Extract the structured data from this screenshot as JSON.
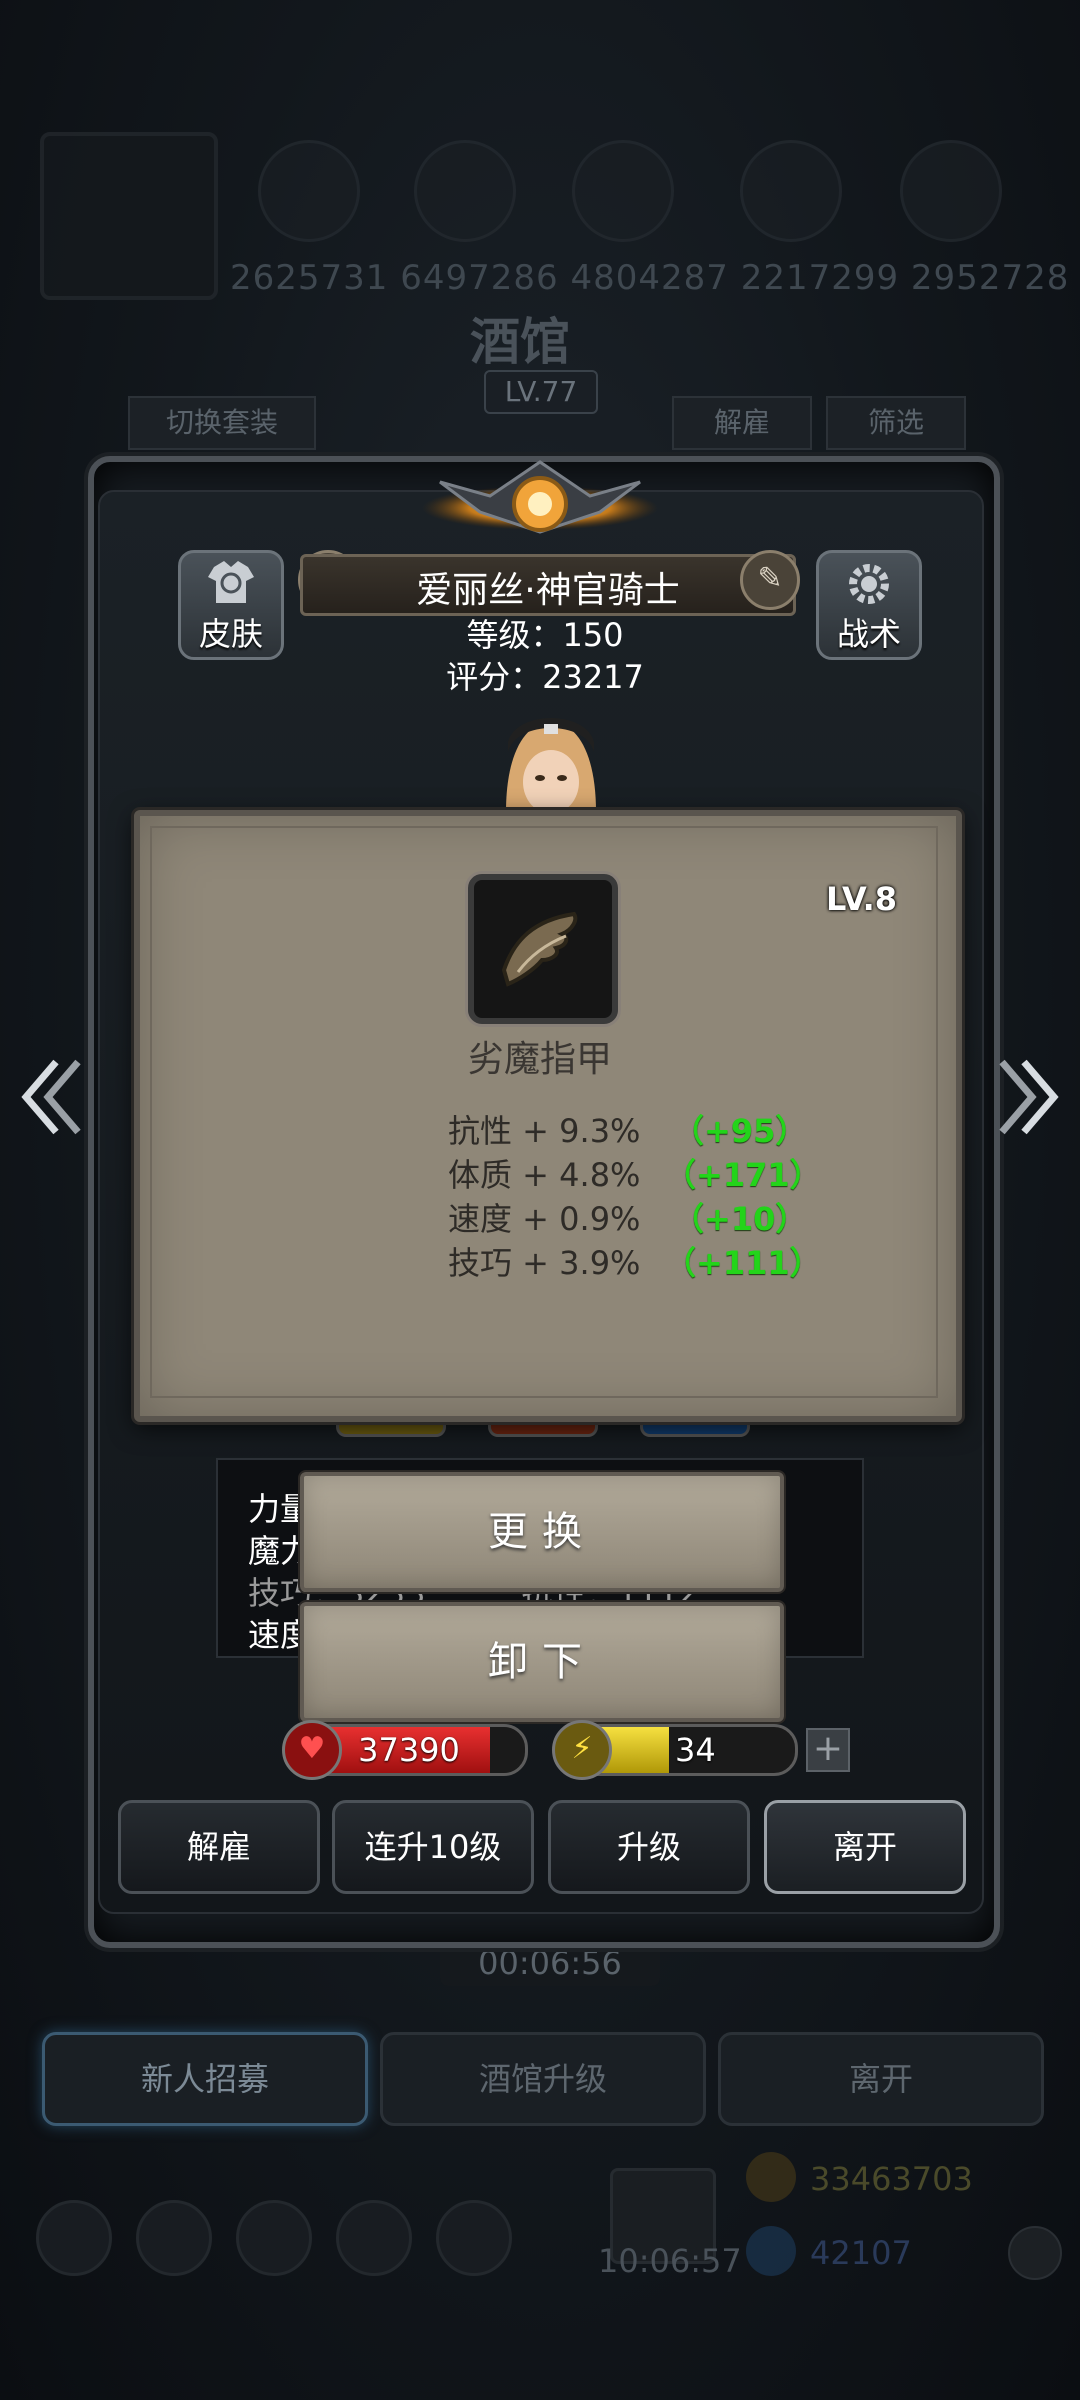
{
  "background": {
    "numbers": "2625731 6497286 4804287 2217299 2952728",
    "title": "酒馆",
    "level": "LV.77",
    "tab_switch": "切换套装",
    "tab_dismiss": "解雇",
    "tab_filter": "筛选",
    "timer": "00:06:56",
    "bottom_buttons": [
      "新人招募",
      "酒馆升级",
      "离开"
    ],
    "clock": "10:06:57",
    "gold": "33463703",
    "gems": "42107"
  },
  "hero": {
    "skin_label": "皮肤",
    "tactics_label": "战术",
    "name": "爱丽丝·神官骑士",
    "level_text": "等级：150",
    "score_text": "评分：23217",
    "stats_lines": [
      "力量",
      "魔力",
      "技巧：3233　　　抗性：1112",
      "速度"
    ]
  },
  "item": {
    "level": "LV.8",
    "name": "劣魔指甲",
    "attributes": [
      {
        "label": "抗性 + 9.3%",
        "bonus": "（+95）"
      },
      {
        "label": "体质 + 4.8%",
        "bonus": "（+171）"
      },
      {
        "label": "速度 + 0.9%",
        "bonus": "（+10）"
      },
      {
        "label": "技巧 + 3.9%",
        "bonus": "（+111）"
      }
    ]
  },
  "actions": {
    "replace": "更换",
    "unequip": "卸下"
  },
  "vitals": {
    "hp": "37390",
    "energy": "34",
    "hp_fill": 0.85,
    "energy_fill": 0.45
  },
  "bottom_actions": [
    "解雇",
    "连升10级",
    "升级",
    "离开"
  ],
  "colors": {
    "bonus_green": "#23d41a",
    "hp_red": "#d01818",
    "energy_yellow": "#f0d020"
  },
  "icons": {
    "skin": "shirt-refresh-icon",
    "tactics": "gear-icon",
    "badge": "medal-icon",
    "edit": "edit-pencil-icon",
    "hp": "heart-icon",
    "energy": "lightning-icon",
    "prev": "chevron-left-icon",
    "next": "chevron-right-icon",
    "item": "claw-icon"
  }
}
